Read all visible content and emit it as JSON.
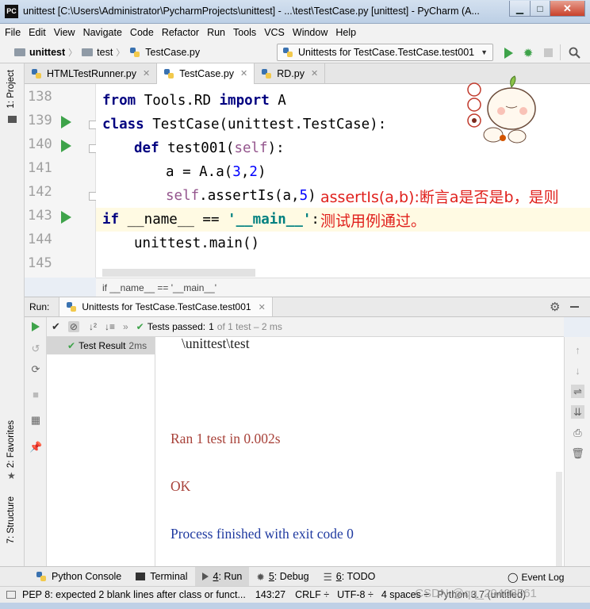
{
  "window": {
    "title": "unittest [C:\\Users\\Administrator\\PycharmProjects\\unittest] - ...\\test\\TestCase.py [unittest] - PyCharm (A...",
    "app_icon": "PC"
  },
  "menu": [
    "File",
    "Edit",
    "View",
    "Navigate",
    "Code",
    "Refactor",
    "Run",
    "Tools",
    "VCS",
    "Window",
    "Help"
  ],
  "nav": {
    "crumbs": [
      "unittest",
      "test",
      "TestCase.py"
    ],
    "run_config": "Unittests for TestCase.TestCase.test001"
  },
  "tabs": [
    "HTMLTestRunner.py",
    "TestCase.py",
    "RD.py"
  ],
  "left_stripe": {
    "project": "1: Project",
    "favorites": "2: Favorites",
    "structure": "7: Structure"
  },
  "editor": {
    "line_numbers": [
      "138",
      "139",
      "140",
      "141",
      "142",
      "143",
      "144",
      "145"
    ],
    "code": {
      "l138_kw1": "from",
      "l138_a": " Tools.RD ",
      "l138_kw2": "import",
      "l138_b": " A",
      "l139_kw": "class",
      "l139_a": " TestCase(unittest.TestCase):",
      "l140_kw": "def",
      "l140_a": " test001(",
      "l140_self": "self",
      "l140_b": "):",
      "l141_a": "a = A.a(",
      "l141_n1": "3",
      "l141_c": ",",
      "l141_n2": "2",
      "l141_b": ")",
      "l142_self": "self",
      "l142_a": ".assertIs(a,",
      "l142_n": "5",
      "l142_b": ")",
      "l143_kw": "if",
      "l143_a": " __name__ == ",
      "l143_str": "'__main__'",
      "l143_b": ":",
      "l144_a": "unittest.main()"
    },
    "annotation_line1": "assertIs(a,b):断言a是否是b，是则",
    "annotation_line2": "测试用例通过。",
    "breadcrumb": "if __name__ == '__main__'"
  },
  "run_panel": {
    "label": "Run:",
    "tab": "Unittests for TestCase.TestCase.test001",
    "tests_passed_label": "Tests passed:",
    "tests_passed_count": "1",
    "tests_passed_detail": "of 1 test – 2 ms",
    "tree_item": "Test Result",
    "tree_time": "2ms",
    "console": [
      "\\unittest\\test",
      "Ran 1 test in 0.002s",
      "OK",
      "Process finished with exit code 0"
    ]
  },
  "tool_tabs": [
    {
      "num": "",
      "label": "Python Console"
    },
    {
      "num": "",
      "label": "Terminal"
    },
    {
      "num": "4",
      "label": ": Run"
    },
    {
      "num": "5",
      "label": ": Debug"
    },
    {
      "num": "6",
      "label": ": TODO"
    }
  ],
  "event_log": "Event Log",
  "status": {
    "message": "PEP 8: expected 2 blank lines after class or funct...",
    "position": "143:27",
    "line_sep": "CRLF ÷",
    "encoding": "UTF-8 ÷",
    "indent": "4 spaces ÷",
    "interpreter": "Python 3.7 (untitled)",
    "watermark": "CSDN @qq_29408561"
  },
  "colors": {
    "keyword": "#000080",
    "self": "#94558d",
    "number": "#0000ff",
    "string": "#008080",
    "annotation": "#e0201c",
    "run_green": "#3ea34a",
    "console_red": "#a8423a",
    "console_blue": "#1f3aa0"
  }
}
